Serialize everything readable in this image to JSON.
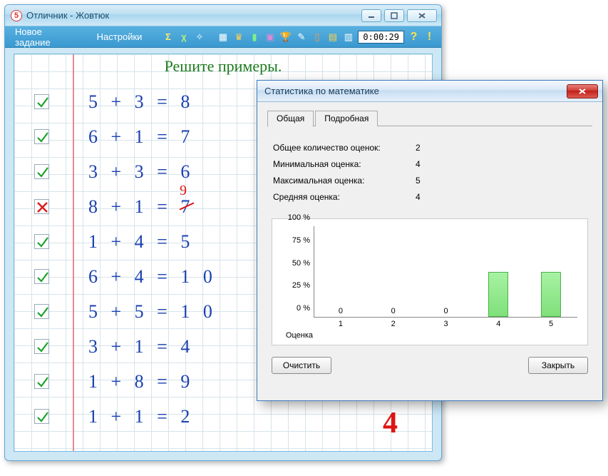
{
  "window": {
    "title": "Отличник - Жовтюк",
    "icon_char": "5"
  },
  "menu": {
    "new_task": "Новое задание",
    "settings": "Настройки"
  },
  "timer": "0:00:29",
  "worksheet": {
    "title": "Решите примеры.",
    "grade": "4",
    "problems": [
      {
        "text": "5 + 3 = 8",
        "correct": true
      },
      {
        "text": "6 + 1 = 7",
        "correct": true
      },
      {
        "text": "3 + 3 = 6",
        "correct": true
      },
      {
        "text": "8 + 1 = 7",
        "correct": false,
        "correction": "9"
      },
      {
        "text": "1 + 4 = 5",
        "correct": true
      },
      {
        "text": "6 + 4 = 1 0",
        "correct": true
      },
      {
        "text": "5 + 5 = 1 0",
        "correct": true
      },
      {
        "text": "3 + 1 = 4",
        "correct": true
      },
      {
        "text": "1 + 8 = 9",
        "correct": true
      },
      {
        "text": "1 + 1 = 2",
        "correct": true
      }
    ]
  },
  "dialog": {
    "title": "Статистика по математике",
    "tabs": {
      "general": "Общая",
      "detailed": "Подробная"
    },
    "stats": {
      "total_label": "Общее количество оценок:",
      "total_value": "2",
      "min_label": "Минимальная оценка:",
      "min_value": "4",
      "max_label": "Максимальная оценка:",
      "max_value": "5",
      "avg_label": "Средняя оценка:",
      "avg_value": "4"
    },
    "buttons": {
      "clear": "Очистить",
      "close": "Закрыть"
    }
  },
  "chart_data": {
    "type": "bar",
    "categories": [
      "1",
      "2",
      "3",
      "4",
      "5"
    ],
    "values": [
      0,
      0,
      0,
      50,
      50
    ],
    "xlabel": "Оценка",
    "ylabel": "",
    "y_ticks": [
      "0 %",
      "25 %",
      "50 %",
      "75 %",
      "100 %"
    ],
    "ylim": [
      0,
      100
    ]
  }
}
